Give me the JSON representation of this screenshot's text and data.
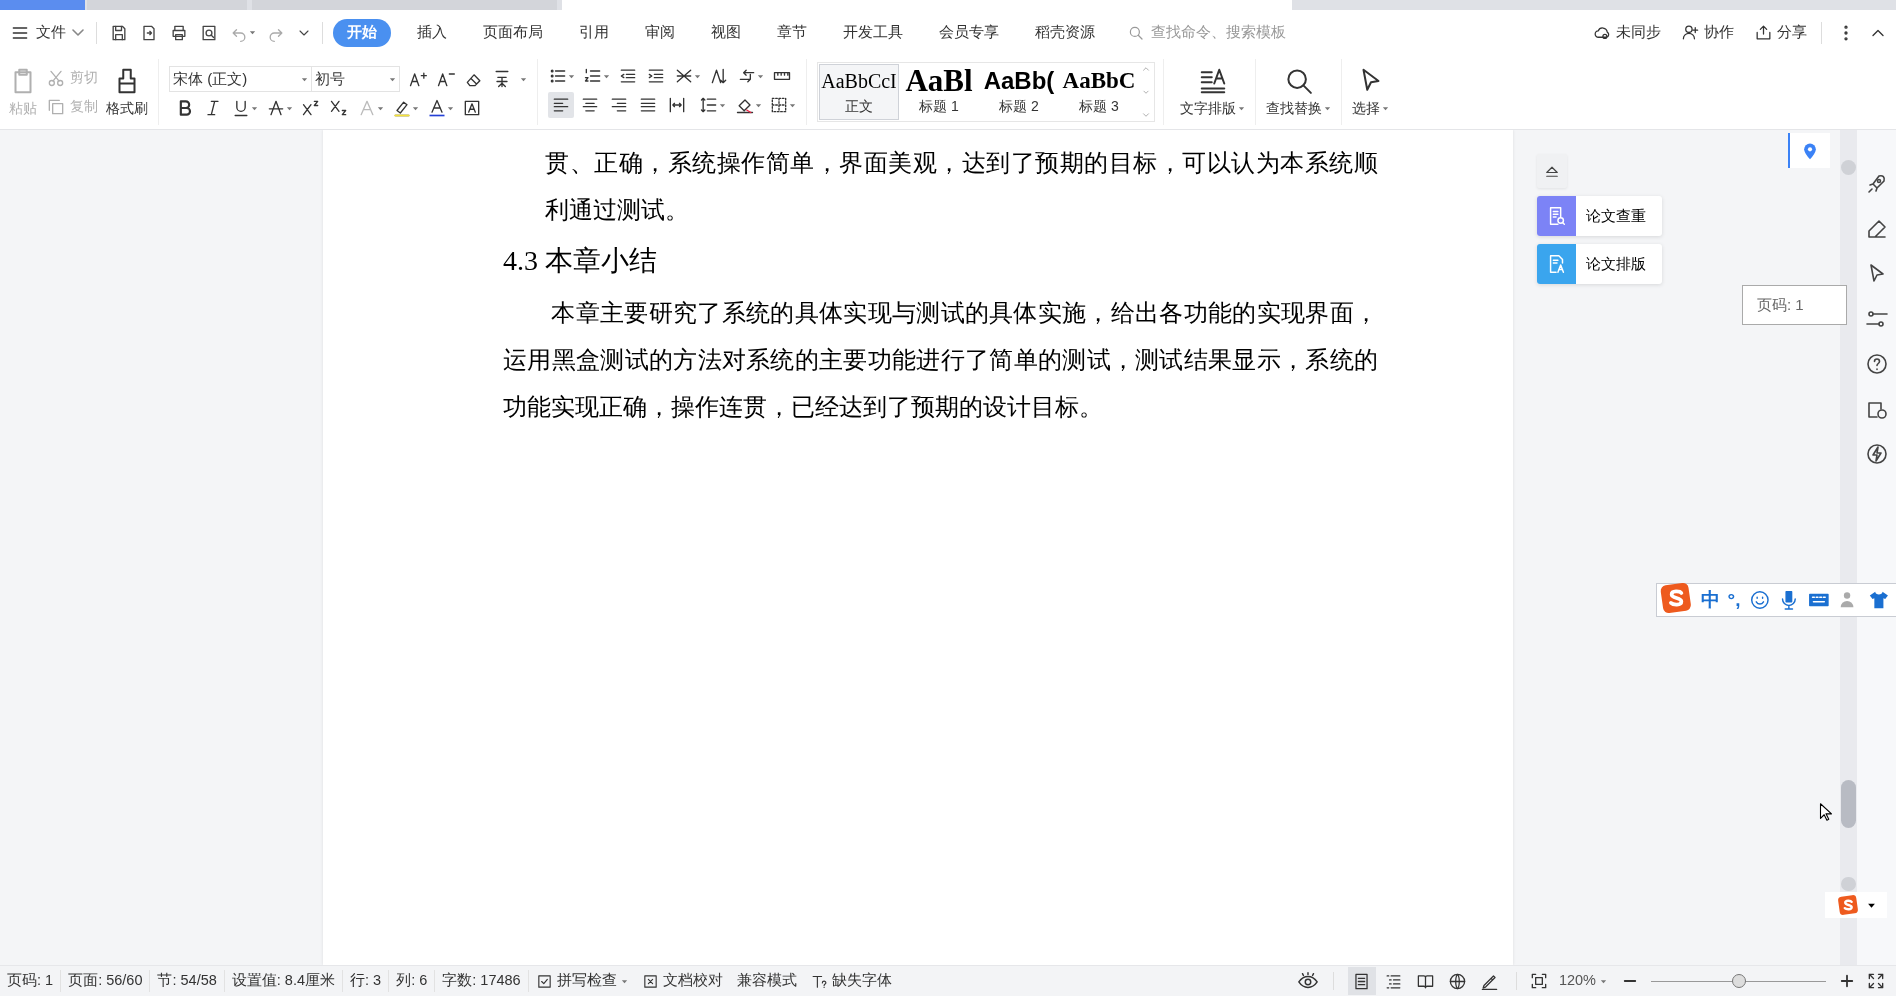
{
  "menu": {
    "file_label": "文件",
    "tabs": [
      {
        "label": "开始",
        "selected": true
      },
      {
        "label": "插入",
        "selected": false
      },
      {
        "label": "页面布局",
        "selected": false
      },
      {
        "label": "引用",
        "selected": false
      },
      {
        "label": "审阅",
        "selected": false
      },
      {
        "label": "视图",
        "selected": false
      },
      {
        "label": "章节",
        "selected": false
      },
      {
        "label": "开发工具",
        "selected": false
      },
      {
        "label": "会员专享",
        "selected": false
      },
      {
        "label": "稻壳资源",
        "selected": false
      }
    ],
    "search": {
      "placeholder": "查找命令、搜索模板"
    },
    "actions": [
      {
        "kind": "sync",
        "label": "未同步"
      },
      {
        "kind": "collab",
        "label": "协作"
      },
      {
        "kind": "share",
        "label": "分享"
      }
    ]
  },
  "toolbar": {
    "clipboard": [
      {
        "kind": "paste",
        "label": "粘贴",
        "disabled": true
      },
      {
        "kind": "cut",
        "label": "剪切",
        "disabled": true
      },
      {
        "kind": "copy",
        "label": "复制",
        "disabled": true
      },
      {
        "kind": "painter",
        "label": "格式刷",
        "disabled": false
      }
    ],
    "font": {
      "name": "宋体 (正文)",
      "size": "初号"
    },
    "alignment": [
      {
        "kind": "left",
        "selected": true
      },
      {
        "kind": "center",
        "selected": false
      },
      {
        "kind": "right",
        "selected": false
      },
      {
        "kind": "justify",
        "selected": false
      },
      {
        "kind": "distribute",
        "selected": false
      }
    ],
    "styles": [
      {
        "kind": "body",
        "preview": "AaBbCcI",
        "label": "正文",
        "selected": true
      },
      {
        "kind": "h1",
        "preview": "AaBl",
        "label": "标题 1",
        "selected": false
      },
      {
        "kind": "h2",
        "preview": "AaBb(",
        "label": "标题 2",
        "selected": false
      },
      {
        "kind": "h3",
        "preview": "AaBbC",
        "label": "标题 3",
        "selected": false
      }
    ],
    "tools": [
      {
        "kind": "layout",
        "label": "文字排版"
      },
      {
        "kind": "find",
        "label": "查找替换"
      },
      {
        "kind": "select",
        "label": "选择"
      }
    ]
  },
  "document": {
    "blocks": [
      {
        "kind": "continuation",
        "text": "贯、正确，系统操作简单，界面美观，达到了预期的目标，可以认为本系统顺利通过测试。"
      },
      {
        "kind": "heading",
        "text": "4.3 本章小结"
      },
      {
        "kind": "paragraph",
        "text": "本章主要研究了系统的具体实现与测试的具体实施，给出各功能的实现界面，运用黑盒测试的方法对系统的主要功能进行了简单的测试，测试结果显示，系统的功能实现正确，操作连贯，已经达到了预期的设计目标。"
      }
    ]
  },
  "side_panel": {
    "tools": [
      {
        "kind": "check",
        "label": "论文查重",
        "color": "#7c83f6"
      },
      {
        "kind": "format",
        "label": "论文排版",
        "color": "#3aa5ee"
      }
    ],
    "page_indicator": "页码: 1"
  },
  "ime_bar": {
    "mode": "中",
    "punctuation": "°,"
  },
  "status_bar": {
    "items": [
      "页码: 1",
      "页面: 56/60",
      "节: 54/58",
      "设置值: 8.4厘米",
      "行: 3",
      "列: 6",
      "字数: 17486"
    ],
    "tools": [
      {
        "kind": "spell",
        "label": "拼写检查"
      },
      {
        "kind": "proof",
        "label": "文档校对"
      },
      {
        "kind": "plain",
        "label": "兼容模式"
      },
      {
        "kind": "font",
        "label": "缺失字体"
      }
    ],
    "views": [
      {
        "kind": "page",
        "selected": true
      },
      {
        "kind": "outline",
        "selected": false
      },
      {
        "kind": "read",
        "selected": false
      },
      {
        "kind": "web",
        "selected": false
      },
      {
        "kind": "write",
        "selected": false
      }
    ],
    "zoom": "120%",
    "zoom_slider": {
      "level": 0.5
    }
  }
}
